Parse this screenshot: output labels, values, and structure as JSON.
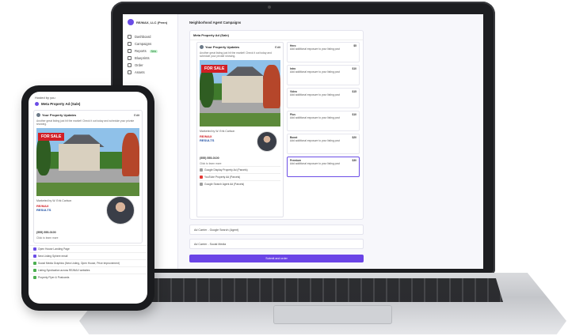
{
  "app": {
    "org_name": "RE/MAX, LLC (Penn)",
    "sidebar": [
      {
        "label": "Dashboard"
      },
      {
        "label": "Campaigns"
      },
      {
        "label": "Reports",
        "badge": "New"
      },
      {
        "label": "Blueprints"
      },
      {
        "label": "Order"
      },
      {
        "label": "Assets"
      }
    ],
    "sidebar_bottom": [
      "What's new?",
      "Settings",
      "Emily Dimpfl…"
    ],
    "page_title": "Neighborhood Agent Campaigns",
    "panel_title": "Meta Property Ad (Sale)",
    "post": {
      "title": "Your Property Updates",
      "edit_label": "Edit",
      "body": "Another great listing just hit the market! Check it out today and schedule your private showing.",
      "for_sale": "FOR SALE",
      "marketed_by": "Marketed by W. Erik Carlson",
      "remax": "RE/MAX",
      "remax_sub": "RESULTS",
      "phone": "(555) 555-0100",
      "phone_sub": "Click to learn more"
    },
    "ads": [
      {
        "label": "Google Display Property Ad (Parcels)",
        "color": "gray"
      },
      {
        "label": "YouTube Property Ad (Parcels)",
        "color": "red"
      },
      {
        "label": "Google Search Agent Ad (Parcels)",
        "color": "gray"
      }
    ],
    "cards": [
      {
        "title": "Hero",
        "price": "$5",
        "desc": "Add additional exposure to your listing post"
      },
      {
        "title": "Intro",
        "price": "$10",
        "desc": "Add additional exposure to your listing post"
      },
      {
        "title": "Video",
        "price": "$15",
        "desc": "Add additional exposure to your listing post"
      },
      {
        "title": "Plus",
        "price": "$10",
        "desc": "Add additional exposure to your listing post"
      },
      {
        "title": "Boost",
        "price": "$20",
        "desc": "Add additional exposure to your listing post"
      },
      {
        "title": "Premium",
        "price": "$30",
        "desc": "Add additional exposure to your listing post"
      }
    ],
    "accordions": [
      "Ad Carrier - Google Search (Agent)",
      "Ad Carrier - Social Media"
    ],
    "cta": "Submit and order"
  },
  "phone": {
    "header": "Hosted by you",
    "title": "Meta Property Ad (Sale)",
    "post_title": "Your Property Updates",
    "edit_label": "Edit",
    "body": "Another great listing just hit the market! Check it out today and schedule your private showing.",
    "for_sale": "FOR SALE",
    "marketed_by": "Marketed by W. Erik Carlson",
    "remax": "RE/MAX",
    "remax_sub": "RESULTS",
    "phone": "(555) 555-0100",
    "phone_sub": "Click to learn more",
    "rows": [
      "Open House Landing Page",
      "New Listing Sphere email",
      "Social Media Graphics (New Listing, Open House, Price Improvement)",
      "Listing Syndication across RE/MAX websites",
      "Property Flyer & Postcards"
    ]
  }
}
